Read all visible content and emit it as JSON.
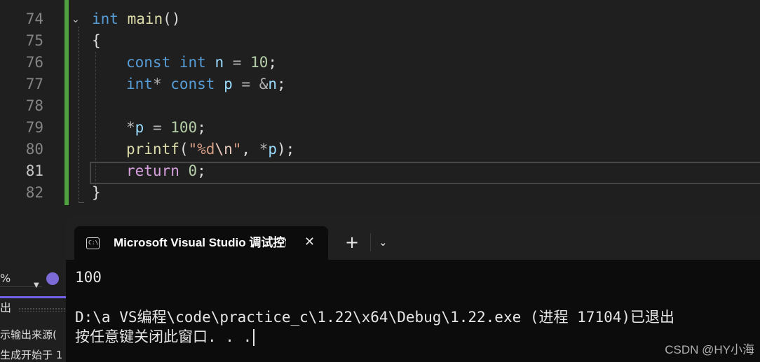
{
  "editor": {
    "lines": [
      {
        "num": "74"
      },
      {
        "num": "75"
      },
      {
        "num": "76"
      },
      {
        "num": "77"
      },
      {
        "num": "78"
      },
      {
        "num": "79"
      },
      {
        "num": "80"
      },
      {
        "num": "81"
      },
      {
        "num": "82"
      }
    ],
    "current_line": "81",
    "code": {
      "l74_kw": "int",
      "l74_fn": "main",
      "l74_paren": "()",
      "l75": "{",
      "l76_kw1": "const",
      "l76_kw2": "int",
      "l76_var": "n",
      "l76_op": " = ",
      "l76_num": "10",
      "l76_end": ";",
      "l77_kw1": "int",
      "l77_star": "* ",
      "l77_kw2": "const",
      "l77_var": "p",
      "l77_op": " = &",
      "l77_var2": "n",
      "l77_end": ";",
      "l79_op": "*",
      "l79_var": "p",
      "l79_op2": " = ",
      "l79_num": "100",
      "l79_end": ";",
      "l80_fn": "printf",
      "l80_open": "(",
      "l80_str1": "\"%d",
      "l80_esc": "\\n",
      "l80_str2": "\"",
      "l80_comma": ", ",
      "l80_op": "*",
      "l80_var": "p",
      "l80_close": ");",
      "l81_kw": "return",
      "l81_num": "0",
      "l81_end": ";",
      "l82": "}"
    }
  },
  "left_panel": {
    "zoom": "%",
    "output_tab": "出",
    "output_source": "示输出来源(",
    "build_line": "生成开始于  1"
  },
  "terminal": {
    "tab_title": "Microsoft Visual Studio 调试控制台",
    "icon_text": "C:\\",
    "close": "✕",
    "new_tab": "+",
    "dropdown": "⌄",
    "out_line1": "100",
    "out_line2": "D:\\a VS编程\\code\\practice_c\\1.22\\x64\\Debug\\1.22.exe (进程 17104)已退出",
    "out_line3": "按任意键关闭此窗口. . ."
  },
  "watermark": "CSDN @HY小海"
}
